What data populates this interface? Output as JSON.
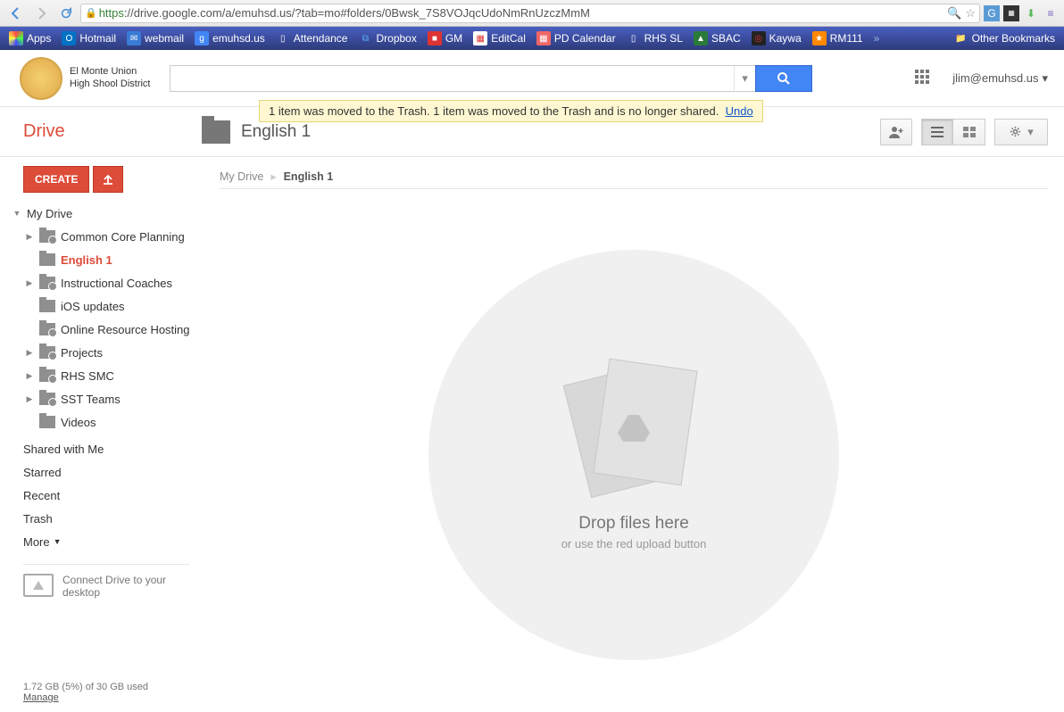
{
  "browser": {
    "url_https": "https",
    "url_rest": "://drive.google.com/a/emuhsd.us/?tab=mo#folders/0Bwsk_7S8VOJqcUdoNmRnUzczMmM"
  },
  "bookmarks": {
    "apps": "Apps",
    "items": [
      "Hotmail",
      "webmail",
      "emuhsd.us",
      "Attendance",
      "Dropbox",
      "GM",
      "EditCal",
      "PD Calendar",
      "RHS SL",
      "SBAC",
      "Kaywa",
      "RM111"
    ],
    "other": "Other Bookmarks"
  },
  "header": {
    "logo_line1": "El Monte Union",
    "logo_line2": "High Shool District",
    "user": "jlim@emuhsd.us"
  },
  "toast": {
    "text": "1 item was moved to the Trash. 1 item was moved to the Trash and is no longer shared.",
    "undo": "Undo"
  },
  "toolbar": {
    "drive": "Drive",
    "folder": "English 1"
  },
  "sidebar": {
    "create": "CREATE",
    "root": "My Drive",
    "folders": [
      {
        "label": "Common Core Planning",
        "shared": true,
        "arrow": true
      },
      {
        "label": "English 1",
        "shared": false,
        "arrow": false,
        "selected": true
      },
      {
        "label": "Instructional Coaches",
        "shared": true,
        "arrow": true
      },
      {
        "label": "iOS updates",
        "shared": false,
        "arrow": false
      },
      {
        "label": "Online Resource Hosting",
        "shared": true,
        "arrow": false
      },
      {
        "label": "Projects",
        "shared": true,
        "arrow": true
      },
      {
        "label": "RHS SMC",
        "shared": true,
        "arrow": true
      },
      {
        "label": "SST Teams",
        "shared": true,
        "arrow": true
      },
      {
        "label": "Videos",
        "shared": false,
        "arrow": false
      }
    ],
    "nav": {
      "shared": "Shared with Me",
      "starred": "Starred",
      "recent": "Recent",
      "trash": "Trash",
      "more": "More"
    },
    "connect": "Connect Drive to your desktop",
    "storage": "1.72 GB (5%) of 30 GB used",
    "manage": "Manage"
  },
  "breadcrumb": {
    "root": "My Drive",
    "current": "English 1"
  },
  "empty": {
    "title": "Drop files here",
    "sub": "or use the red upload button"
  }
}
